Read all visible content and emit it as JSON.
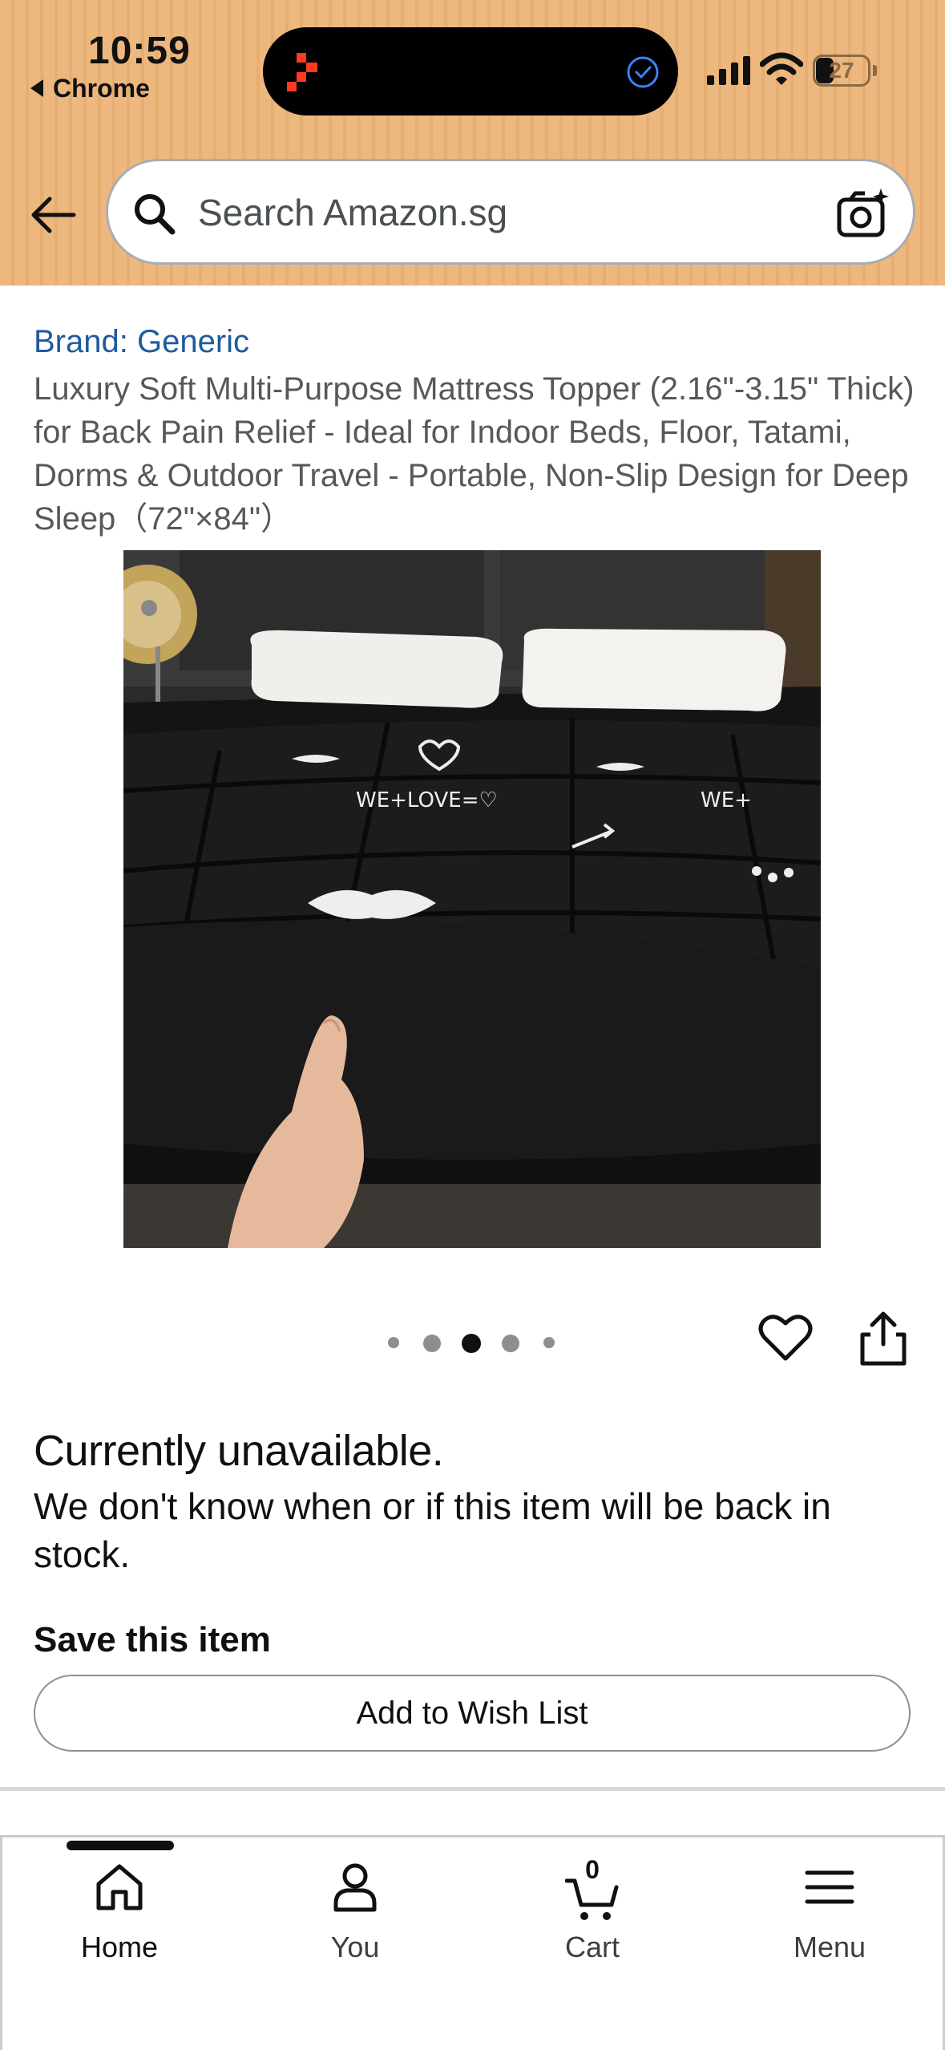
{
  "status_bar": {
    "time": "10:59",
    "back_app": "Chrome",
    "battery": "27"
  },
  "search": {
    "placeholder": "Search Amazon.sg"
  },
  "product": {
    "brand": "Brand: Generic",
    "title": "Luxury Soft Multi-Purpose Mattress Topper (2.16\"-3.15\" Thick) for Back Pain Relief - Ideal for Indoor Beds, Floor, Tatami, Dorms & Outdoor Travel - Portable, Non-Slip Design for Deep Sleep（72\"×84\"）",
    "image_dots": {
      "count": 5,
      "active_index": 2
    }
  },
  "availability": {
    "heading": "Currently unavailable.",
    "message": "We don't know when or if this item will be back in stock."
  },
  "save": {
    "heading": "Save this item",
    "button_label": "Add to Wish List"
  },
  "bottom_nav": {
    "items": [
      {
        "label": "Home",
        "icon": "home-icon"
      },
      {
        "label": "You",
        "icon": "person-icon"
      },
      {
        "label": "Cart",
        "icon": "cart-icon"
      },
      {
        "label": "Menu",
        "icon": "menu-icon"
      }
    ],
    "cart_count": "0",
    "active": "Home"
  },
  "colors": {
    "header_bg": "#edb87f",
    "brand_link": "#1f5aa0",
    "title_text": "#565959"
  }
}
